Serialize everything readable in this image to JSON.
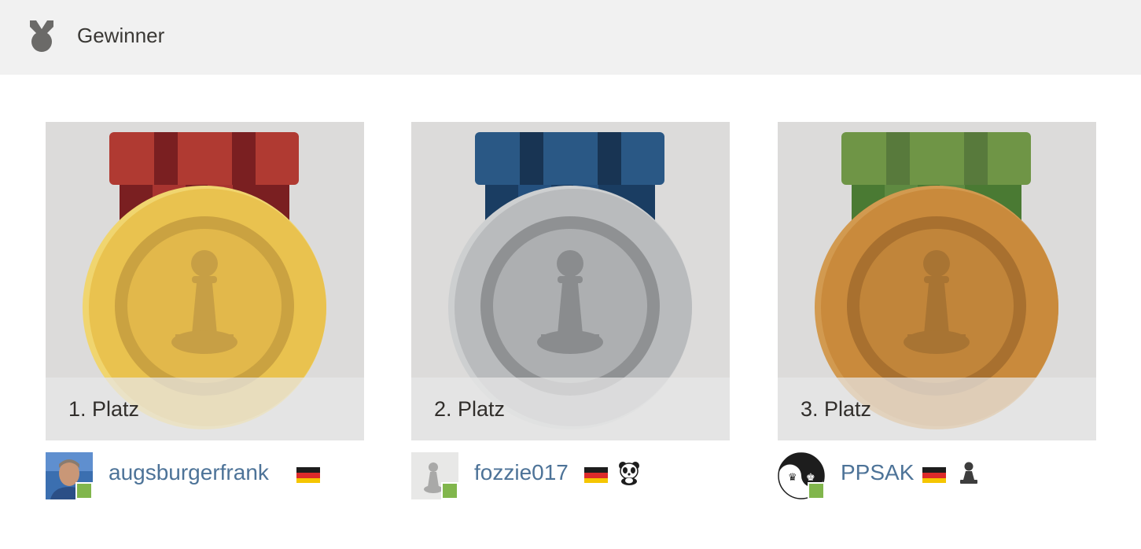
{
  "header": {
    "title": "Gewinner",
    "icon": "medal-icon"
  },
  "winners": [
    {
      "place_label": "1. Platz",
      "medal": "gold-medal",
      "ribbon_color": "#b03a32",
      "medal_color": "#e9c24f",
      "username": "augsburgerfrank",
      "avatar": "user-photo",
      "online": true,
      "flag": "germany-flag-icon"
    },
    {
      "place_label": "2. Platz",
      "medal": "silver-medal",
      "ribbon_color": "#2a5885",
      "medal_color": "#b9bbbd",
      "username": "fozzie017",
      "avatar": "pawn-avatar",
      "online": true,
      "flag": "germany-flag-icon",
      "badge": "panda-icon"
    },
    {
      "place_label": "3. Platz",
      "medal": "bronze-medal",
      "ribbon_color": "#6f9546",
      "medal_color": "#c98a3c",
      "username": "PPSAK",
      "avatar": "yin-yang-chess-avatar",
      "online": true,
      "flag": "germany-flag-icon",
      "badge": "pawn-icon"
    }
  ]
}
